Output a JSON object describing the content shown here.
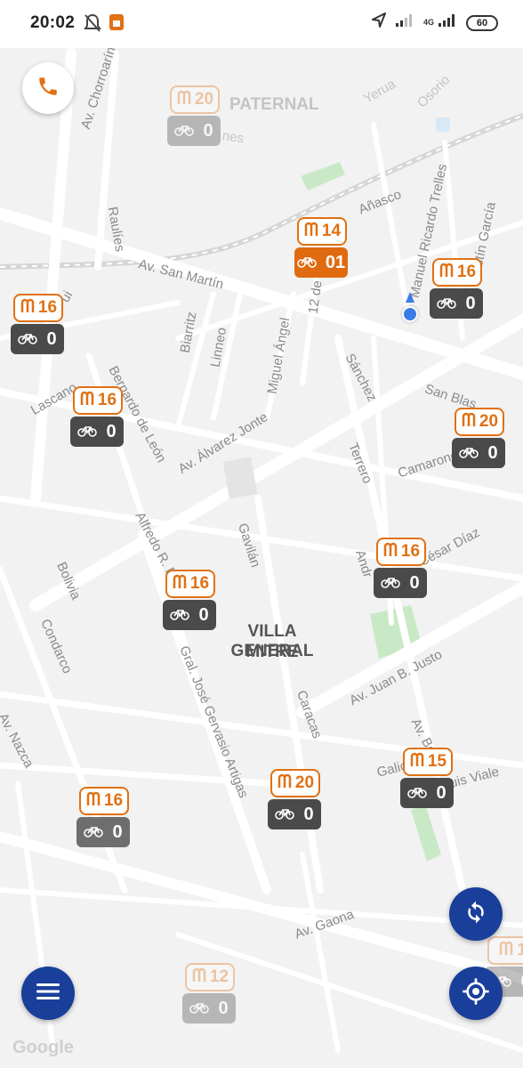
{
  "status_bar": {
    "time": "20:02",
    "network": "4G",
    "battery": "60",
    "icons": [
      "notifications-off-icon",
      "app-notification-icon",
      "location-icon",
      "signal-icon",
      "signal-icon",
      "battery-icon"
    ]
  },
  "map": {
    "districts": [
      {
        "name": "PATERNAL"
      },
      {
        "name": "VILLA GENERAL"
      },
      {
        "name": "MITRE"
      }
    ],
    "streets": [
      {
        "name": "Av. Chorroarín"
      },
      {
        "name": "Raulíes"
      },
      {
        "name": "Yerua"
      },
      {
        "name": "Osorio"
      },
      {
        "name": "Añasco"
      },
      {
        "name": "Manuel Ricardo Trelles"
      },
      {
        "name": "Justín García"
      },
      {
        "name": "Av. San Martín"
      },
      {
        "name": "12 de"
      },
      {
        "name": "Biarritz"
      },
      {
        "name": "Linneo"
      },
      {
        "name": "Miguel Ángel"
      },
      {
        "name": "Sánchez"
      },
      {
        "name": "San Blas"
      },
      {
        "name": "Lascano"
      },
      {
        "name": "Bernardo de León"
      },
      {
        "name": "Av. Álvarez Jonte"
      },
      {
        "name": "Terrero"
      },
      {
        "name": "Camarones"
      },
      {
        "name": "Alfredo R. Bu"
      },
      {
        "name": "Gavilán"
      },
      {
        "name": "Bolivia"
      },
      {
        "name": "César Díaz"
      },
      {
        "name": "Andr"
      },
      {
        "name": "Condarco"
      },
      {
        "name": "Gral. José Gervasio Artigas"
      },
      {
        "name": "Av. Juan B. Justo"
      },
      {
        "name": "Caracas"
      },
      {
        "name": "Av. Nazca"
      },
      {
        "name": "Av. Bo"
      },
      {
        "name": "Galic"
      },
      {
        "name": "uis Viale"
      },
      {
        "name": "Av. Gaona"
      },
      {
        "name": "nes"
      },
      {
        "name": "ui"
      }
    ],
    "attribution": "Google"
  },
  "stations": [
    {
      "docks": "20",
      "bikes": "0"
    },
    {
      "docks": "14",
      "bikes": "01"
    },
    {
      "docks": "16",
      "bikes": "0"
    },
    {
      "docks": "16",
      "bikes": "0"
    },
    {
      "docks": "16",
      "bikes": "0"
    },
    {
      "docks": "20",
      "bikes": "0"
    },
    {
      "docks": "16",
      "bikes": "0"
    },
    {
      "docks": "16",
      "bikes": "0"
    },
    {
      "docks": "15",
      "bikes": "0"
    },
    {
      "docks": "20",
      "bikes": "0"
    },
    {
      "docks": "16",
      "bikes": "0"
    },
    {
      "docks": "12",
      "bikes": "0"
    },
    {
      "docks": "1",
      "bikes": "0"
    }
  ],
  "buttons": {
    "call": "phone-icon",
    "refresh": "refresh-icon",
    "menu": "menu-icon",
    "locate": "locate-icon"
  },
  "colors": {
    "accent": "#e07114",
    "fab": "#1a3f9a",
    "marker_dark": "#4a4a4a",
    "user_location": "#3b7be8"
  }
}
